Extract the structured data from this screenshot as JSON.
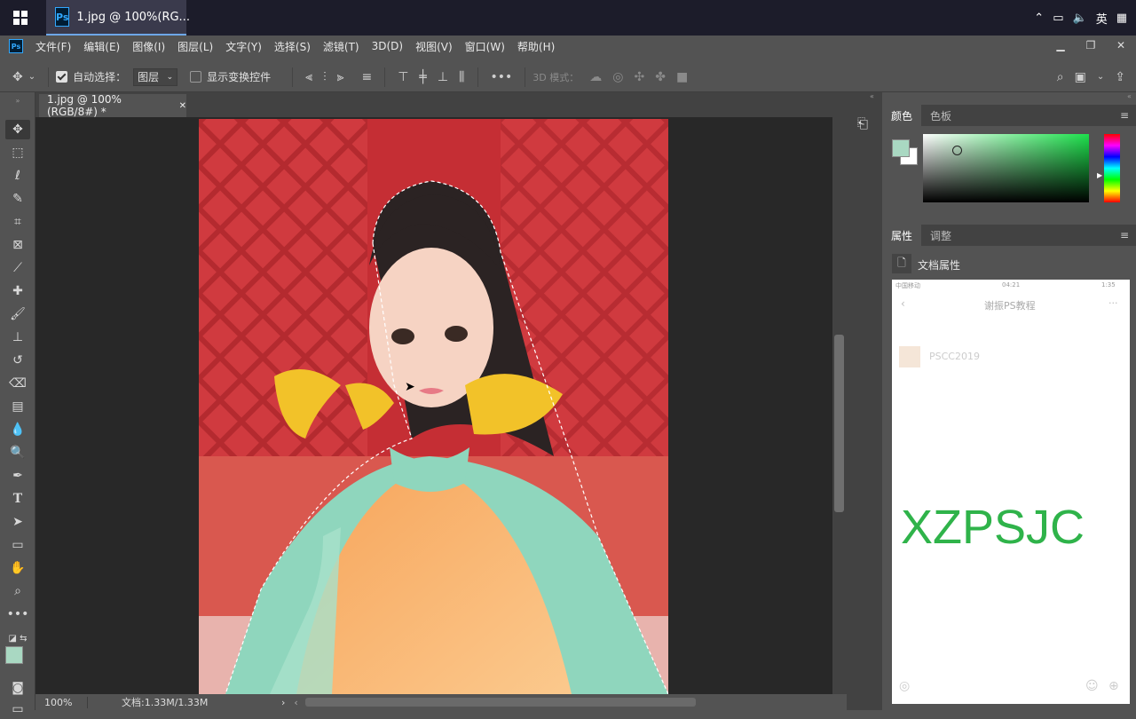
{
  "taskbar": {
    "tab_title": "1.jpg @ 100%(RG...",
    "tray_lang": "英",
    "ps_badge": "Ps"
  },
  "menubar": {
    "items": [
      "文件(F)",
      "编辑(E)",
      "图像(I)",
      "图层(L)",
      "文字(Y)",
      "选择(S)",
      "滤镜(T)",
      "3D(D)",
      "视图(V)",
      "窗口(W)",
      "帮助(H)"
    ]
  },
  "options": {
    "auto_select_label": "自动选择：",
    "auto_select_checked": true,
    "target_value": "图层",
    "show_transform_label": "显示变换控件",
    "show_transform_checked": false,
    "mode3d_label": "3D 模式："
  },
  "document": {
    "tab_title": "1.jpg @ 100%(RGB/8#) *",
    "zoom": "100%",
    "doc_info": "文档:1.33M/1.33M"
  },
  "panels": {
    "color_tab": "颜色",
    "swatches_tab": "色板",
    "properties_tab": "属性",
    "adjust_tab": "调整",
    "doc_props_label": "文档属性",
    "fg_color": "#a9d8c2",
    "bg_color": "#ffffff"
  },
  "phone": {
    "status_left": "中国移动",
    "status_time": "04:21",
    "status_right": "1:35",
    "title": "谢振PS教程",
    "contact_name": "PSCC2019",
    "watermark": "XZPSJC",
    "watermark_color": "#2fb34a"
  }
}
